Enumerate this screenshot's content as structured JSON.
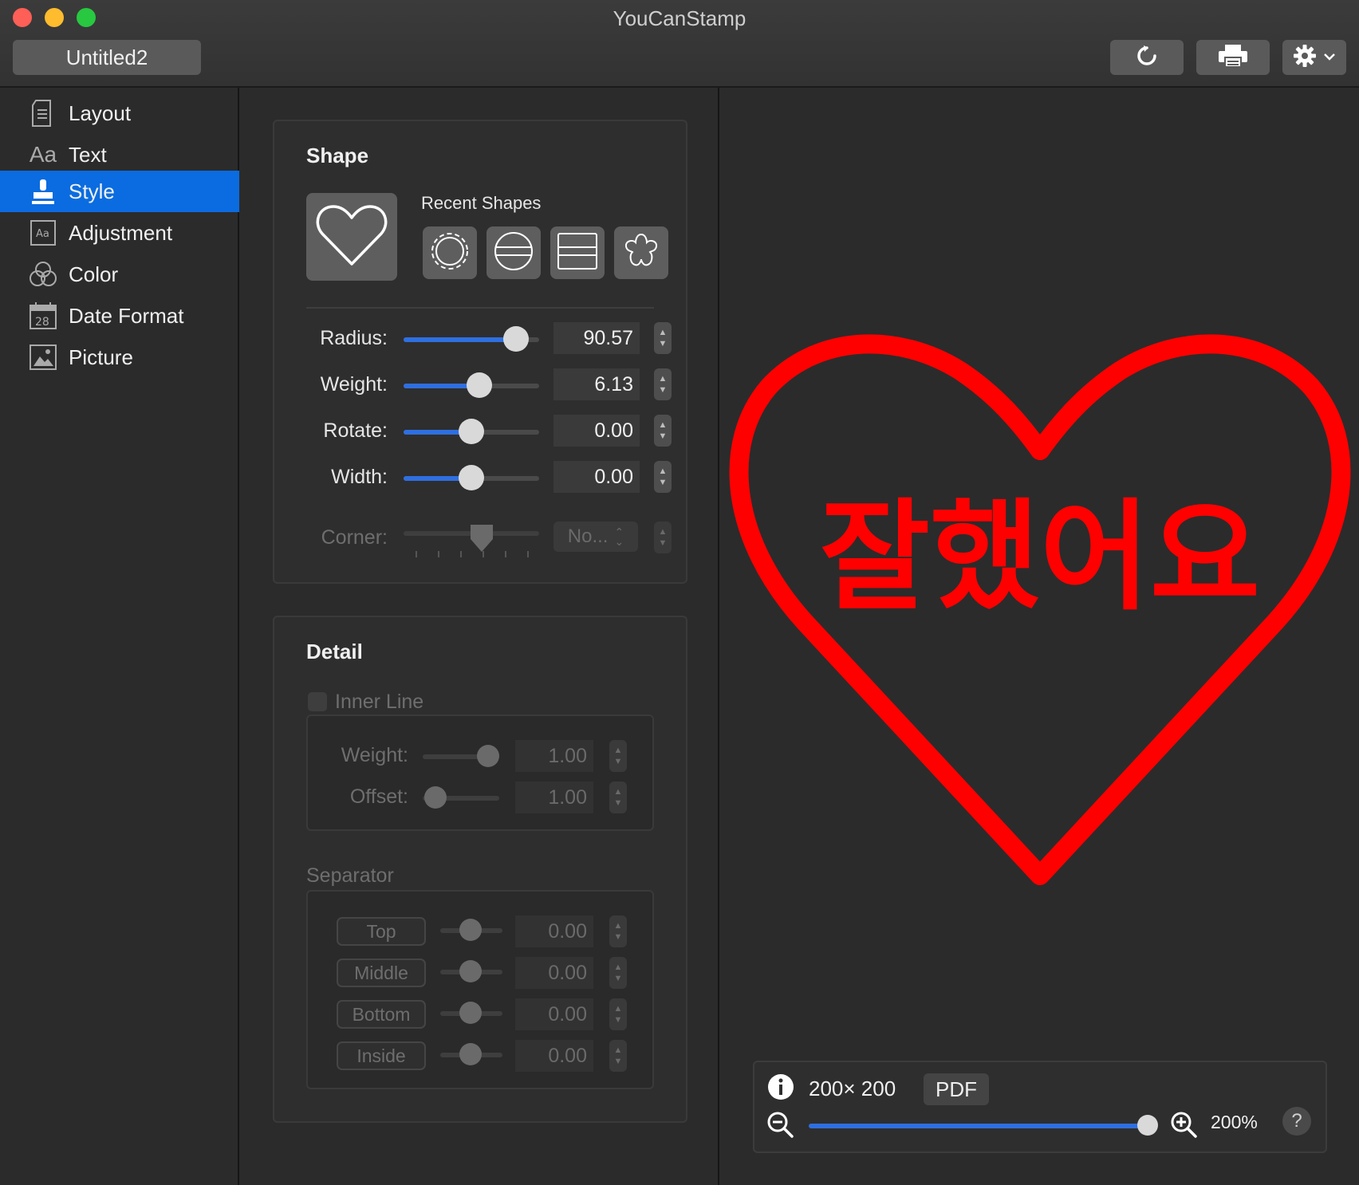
{
  "app": {
    "title": "YouCanStamp",
    "document_title": "Untitled2"
  },
  "toolbar": {
    "refresh_icon": "refresh-icon",
    "print_icon": "printer-icon",
    "settings_icon": "gear-icon"
  },
  "sidebar": {
    "items": [
      {
        "label": "Layout",
        "icon": "layout-icon",
        "active": false
      },
      {
        "label": "Text",
        "icon": "text-icon",
        "active": false
      },
      {
        "label": "Style",
        "icon": "stamp-icon",
        "active": true
      },
      {
        "label": "Adjustment",
        "icon": "adjustment-icon",
        "active": false
      },
      {
        "label": "Color",
        "icon": "color-icon",
        "active": false
      },
      {
        "label": "Date Format",
        "icon": "calendar-icon",
        "active": false
      },
      {
        "label": "Picture",
        "icon": "picture-icon",
        "active": false
      }
    ],
    "calendar_day": "28",
    "active_color": "#0a6ce0"
  },
  "shape": {
    "title": "Shape",
    "recent_label": "Recent Shapes",
    "selected_shape_icon": "heart-icon",
    "recent_icons": [
      "scalloped-circle-icon",
      "circle-lines-icon",
      "rectangle-lines-icon",
      "flower-icon"
    ],
    "rows": [
      {
        "label": "Radius:",
        "value": "90.57",
        "level": 0.83
      },
      {
        "label": "Weight:",
        "value": "6.13",
        "level": 0.56
      },
      {
        "label": "Rotate:",
        "value": "0.00",
        "level": 0.5
      },
      {
        "label": "Width:",
        "value": "0.00",
        "level": 0.5
      }
    ],
    "corner": {
      "label": "Corner:",
      "value": "No..."
    }
  },
  "detail": {
    "title": "Detail",
    "inner_line_label": "Inner Line",
    "inner_rows": [
      {
        "label": "Weight:",
        "value": "1.00"
      },
      {
        "label": "Offset:",
        "value": "1.00"
      }
    ],
    "separator_label": "Separator",
    "separator_rows": [
      {
        "label": "Top",
        "value": "0.00"
      },
      {
        "label": "Middle",
        "value": "0.00"
      },
      {
        "label": "Bottom",
        "value": "0.00"
      },
      {
        "label": "Inside",
        "value": "0.00"
      }
    ]
  },
  "preview": {
    "stamp_text": "잘했어요",
    "stamp_color": "#ff0000",
    "size": "200× 200",
    "format": "PDF",
    "zoom": "200%"
  }
}
